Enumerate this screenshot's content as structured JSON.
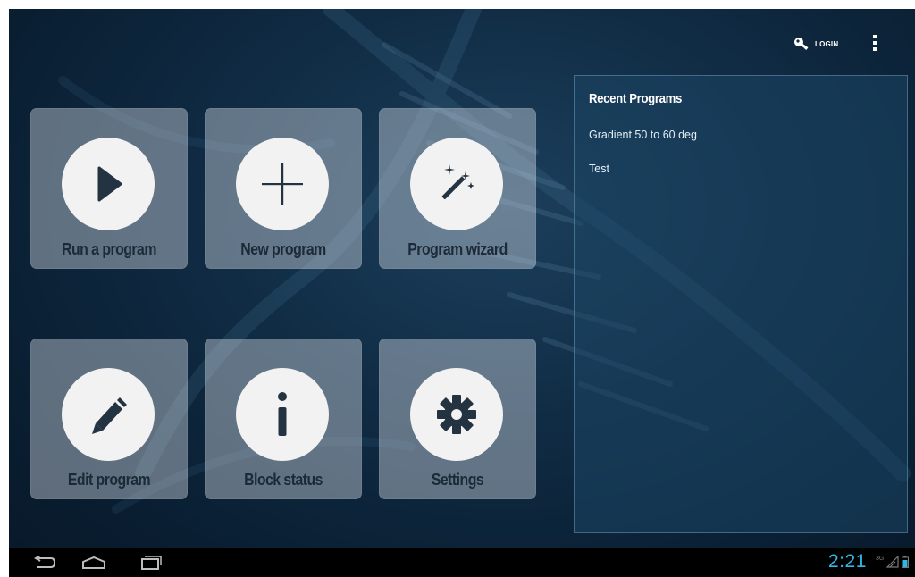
{
  "action_bar": {
    "login_label": "LOGIN",
    "login_icon": "key-icon",
    "overflow_icon": "overflow-menu-icon"
  },
  "tiles": [
    {
      "label": "Run a program",
      "icon": "play-icon"
    },
    {
      "label": "New program",
      "icon": "plus-icon"
    },
    {
      "label": "Program wizard",
      "icon": "magic-wand-icon"
    },
    {
      "label": "Edit program",
      "icon": "pencil-icon"
    },
    {
      "label": "Block status",
      "icon": "info-icon"
    },
    {
      "label": "Settings",
      "icon": "gear-icon"
    }
  ],
  "recent_programs": {
    "title": "Recent Programs",
    "items": [
      "Gradient 50 to 60 deg",
      "Test"
    ]
  },
  "system_bar": {
    "time": "2:21",
    "network_type": "3G",
    "nav_buttons": [
      "back-icon",
      "home-icon",
      "recent-apps-icon"
    ]
  },
  "colors": {
    "background": "#0f2a42",
    "tile": "#8a98a6",
    "tile_text": "#1c2a38",
    "clock": "#33b5e5"
  }
}
